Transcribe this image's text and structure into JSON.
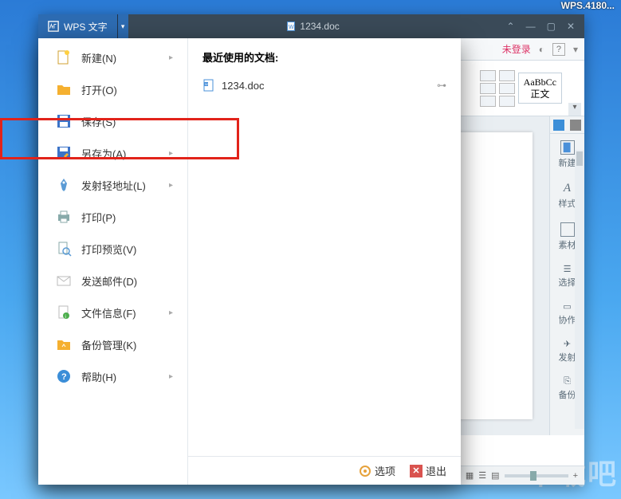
{
  "watermark_top": "WPS.4180...",
  "watermark_bottom": "下载吧",
  "titlebar": {
    "app_name": "WPS 文字",
    "doc_name": "1234.doc"
  },
  "subbar": {
    "login": "未登录"
  },
  "ribbon": {
    "style_serif": "AaBbCc",
    "style_name": "正文"
  },
  "side_panel": {
    "items": [
      {
        "label": "新建"
      },
      {
        "label": "样式"
      },
      {
        "label": "素材"
      },
      {
        "label": "选择"
      },
      {
        "label": "协作"
      },
      {
        "label": "发射"
      },
      {
        "label": "备份"
      }
    ]
  },
  "dropdown": {
    "menu": [
      {
        "label": "新建(N)",
        "icon": "new",
        "submenu": true
      },
      {
        "label": "打开(O)",
        "icon": "open",
        "submenu": false
      },
      {
        "label": "保存(S)",
        "icon": "save",
        "submenu": false
      },
      {
        "label": "另存为(A)",
        "icon": "saveas",
        "submenu": true
      },
      {
        "label": "发射轻地址(L)",
        "icon": "rocket",
        "submenu": true
      },
      {
        "label": "打印(P)",
        "icon": "print",
        "submenu": false
      },
      {
        "label": "打印预览(V)",
        "icon": "preview",
        "submenu": false
      },
      {
        "label": "发送邮件(D)",
        "icon": "mail",
        "submenu": false
      },
      {
        "label": "文件信息(F)",
        "icon": "info",
        "submenu": true
      },
      {
        "label": "备份管理(K)",
        "icon": "backup",
        "submenu": false
      },
      {
        "label": "帮助(H)",
        "icon": "help",
        "submenu": true
      }
    ],
    "recent_header": "最近使用的文档:",
    "recent": [
      {
        "name": "1234.doc"
      }
    ],
    "footer": {
      "options": "选项",
      "exit": "退出"
    }
  }
}
